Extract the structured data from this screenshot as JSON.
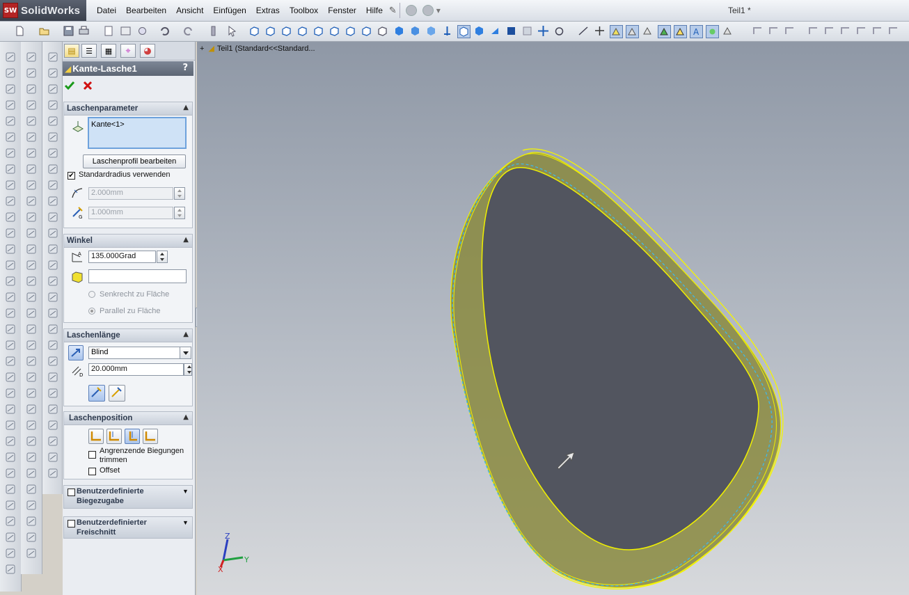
{
  "app": {
    "brand": "SolidWorks",
    "logo_mark": "SW"
  },
  "menu": [
    "Datei",
    "Bearbeiten",
    "Ansicht",
    "Einfügen",
    "Extras",
    "Toolbox",
    "Fenster",
    "Hilfe"
  ],
  "document_title": "Teil1 *",
  "tree": {
    "expand": "+",
    "label": "Teil1  (Standard<<Standard..."
  },
  "property_manager": {
    "title": "Kante-Lasche1",
    "help": "?",
    "groups": {
      "laschenparameter": {
        "title": "Laschenparameter",
        "selection": "Kante<1>",
        "edit_profile_button": "Laschenprofil bearbeiten",
        "use_default_radius_label": "Standardradius verwenden",
        "use_default_radius_checked": true,
        "radius_value": "2.000mm",
        "gap_value": "1.000mm"
      },
      "winkel": {
        "title": "Winkel",
        "angle_value": "135.000Grad",
        "face_selection": "",
        "option_perpendicular": "Senkrecht zu Fläche",
        "option_parallel": "Parallel zu Fläche",
        "selected_option": "Parallel zu Fläche"
      },
      "laschenlaenge": {
        "title": "Laschenlänge",
        "end_condition": "Blind",
        "length_value": "20.000mm"
      },
      "laschenposition": {
        "title": "Laschenposition",
        "trim_label_1": "Angrenzende Biegungen",
        "trim_label_2": "trimmen",
        "trim_checked": false,
        "offset_label": "Offset",
        "offset_checked": false
      },
      "biegezugabe": {
        "title_1": "Benutzerdefinierte",
        "title_2": "Biegezugabe",
        "checked": false
      },
      "freischnitt": {
        "title_1": "Benutzerdefinierter",
        "title_2": "Freischnitt",
        "checked": false
      }
    }
  },
  "triad": {
    "x": "X",
    "y": "Y",
    "z": "Z"
  },
  "colors": {
    "edge_highlight": "#f0f000",
    "preview": "#8a8a40",
    "face": "#52555f",
    "selection_dash": "#3fb8e8"
  }
}
